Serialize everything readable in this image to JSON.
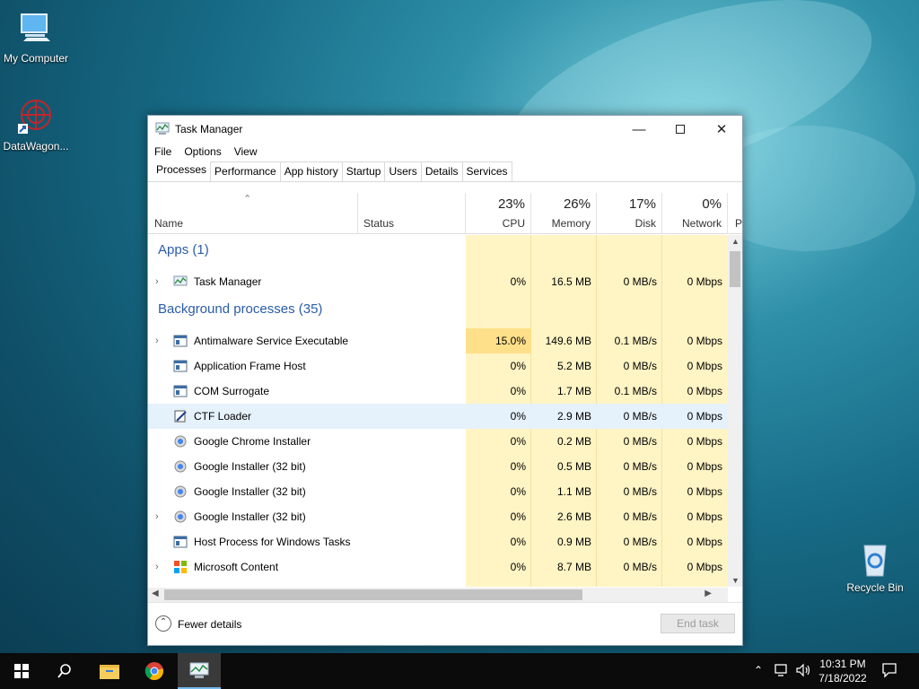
{
  "desktop": {
    "icons": [
      {
        "label": "My Computer"
      },
      {
        "label": "DataWagon..."
      },
      {
        "label": "Recycle Bin"
      }
    ]
  },
  "window": {
    "title": "Task Manager",
    "menu": [
      "File",
      "Options",
      "View"
    ],
    "tabs": [
      "Processes",
      "Performance",
      "App history",
      "Startup",
      "Users",
      "Details",
      "Services"
    ],
    "active_tab": "Processes",
    "columns": {
      "name": "Name",
      "status": "Status",
      "cpu": {
        "label": "CPU",
        "percent": "23%"
      },
      "memory": {
        "label": "Memory",
        "percent": "26%"
      },
      "disk": {
        "label": "Disk",
        "percent": "17%"
      },
      "network": {
        "label": "Network",
        "percent": "0%"
      },
      "power_partial": "P"
    },
    "groups": {
      "apps": "Apps (1)",
      "background": "Background processes (35)"
    },
    "app_rows": [
      {
        "name": "Task Manager",
        "cpu": "0%",
        "memory": "16.5 MB",
        "disk": "0 MB/s",
        "network": "0 Mbps",
        "expandable": true
      }
    ],
    "bg_rows": [
      {
        "name": "Antimalware Service Executable",
        "cpu": "15.0%",
        "memory": "149.6 MB",
        "disk": "0.1 MB/s",
        "network": "0 Mbps",
        "expandable": true
      },
      {
        "name": "Application Frame Host",
        "cpu": "0%",
        "memory": "5.2 MB",
        "disk": "0 MB/s",
        "network": "0 Mbps",
        "expandable": false
      },
      {
        "name": "COM Surrogate",
        "cpu": "0%",
        "memory": "1.7 MB",
        "disk": "0.1 MB/s",
        "network": "0 Mbps",
        "expandable": false
      },
      {
        "name": "CTF Loader",
        "cpu": "0%",
        "memory": "2.9 MB",
        "disk": "0 MB/s",
        "network": "0 Mbps",
        "expandable": false
      },
      {
        "name": "Google Chrome Installer",
        "cpu": "0%",
        "memory": "0.2 MB",
        "disk": "0 MB/s",
        "network": "0 Mbps",
        "expandable": false
      },
      {
        "name": "Google Installer (32 bit)",
        "cpu": "0%",
        "memory": "0.5 MB",
        "disk": "0 MB/s",
        "network": "0 Mbps",
        "expandable": false
      },
      {
        "name": "Google Installer (32 bit)",
        "cpu": "0%",
        "memory": "1.1 MB",
        "disk": "0 MB/s",
        "network": "0 Mbps",
        "expandable": false
      },
      {
        "name": "Google Installer (32 bit)",
        "cpu": "0%",
        "memory": "2.6 MB",
        "disk": "0 MB/s",
        "network": "0 Mbps",
        "expandable": true
      },
      {
        "name": "Host Process for Windows Tasks",
        "cpu": "0%",
        "memory": "0.9 MB",
        "disk": "0 MB/s",
        "network": "0 Mbps",
        "expandable": false
      },
      {
        "name": "Microsoft Content",
        "cpu": "0%",
        "memory": "8.7 MB",
        "disk": "0 MB/s",
        "network": "0 Mbps",
        "expandable": true
      }
    ],
    "footer": {
      "fewer_details": "Fewer details",
      "end_task": "End task"
    }
  },
  "taskbar": {
    "time": "10:31 PM",
    "date": "7/18/2022"
  },
  "colors": {
    "group": "#2a5ca8",
    "heat_light": "#fff4c4",
    "heat_high": "#ffe08a",
    "accent": "#0078d7"
  }
}
